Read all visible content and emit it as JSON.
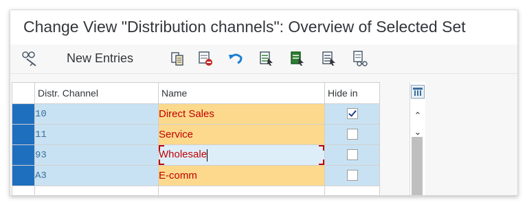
{
  "window": {
    "title": "Change View \"Distribution channels\": Overview of Selected Set"
  },
  "toolbar": {
    "new_entries_label": "New Entries",
    "icons": [
      "display-change-icon",
      "copy-as-icon",
      "delete-icon",
      "undo-icon",
      "select-all-icon",
      "select-block-icon",
      "deselect-all-icon",
      "print-icon"
    ]
  },
  "table": {
    "headers": {
      "channel": "Distr. Channel",
      "name": "Name",
      "hide": "Hide in"
    },
    "rows": [
      {
        "code": "10",
        "name": "Direct Sales",
        "hide": true
      },
      {
        "code": "11",
        "name": "Service",
        "hide": false
      },
      {
        "code": "93",
        "name": "Wholesale",
        "hide": false
      },
      {
        "code": "A3",
        "name": "E-comm",
        "hide": false
      }
    ]
  },
  "colors": {
    "key_cell": "#c9e2f3",
    "editable_cell": "#fcd98c",
    "selection_marker": "#1f6fbf",
    "text_red": "#c00000"
  }
}
